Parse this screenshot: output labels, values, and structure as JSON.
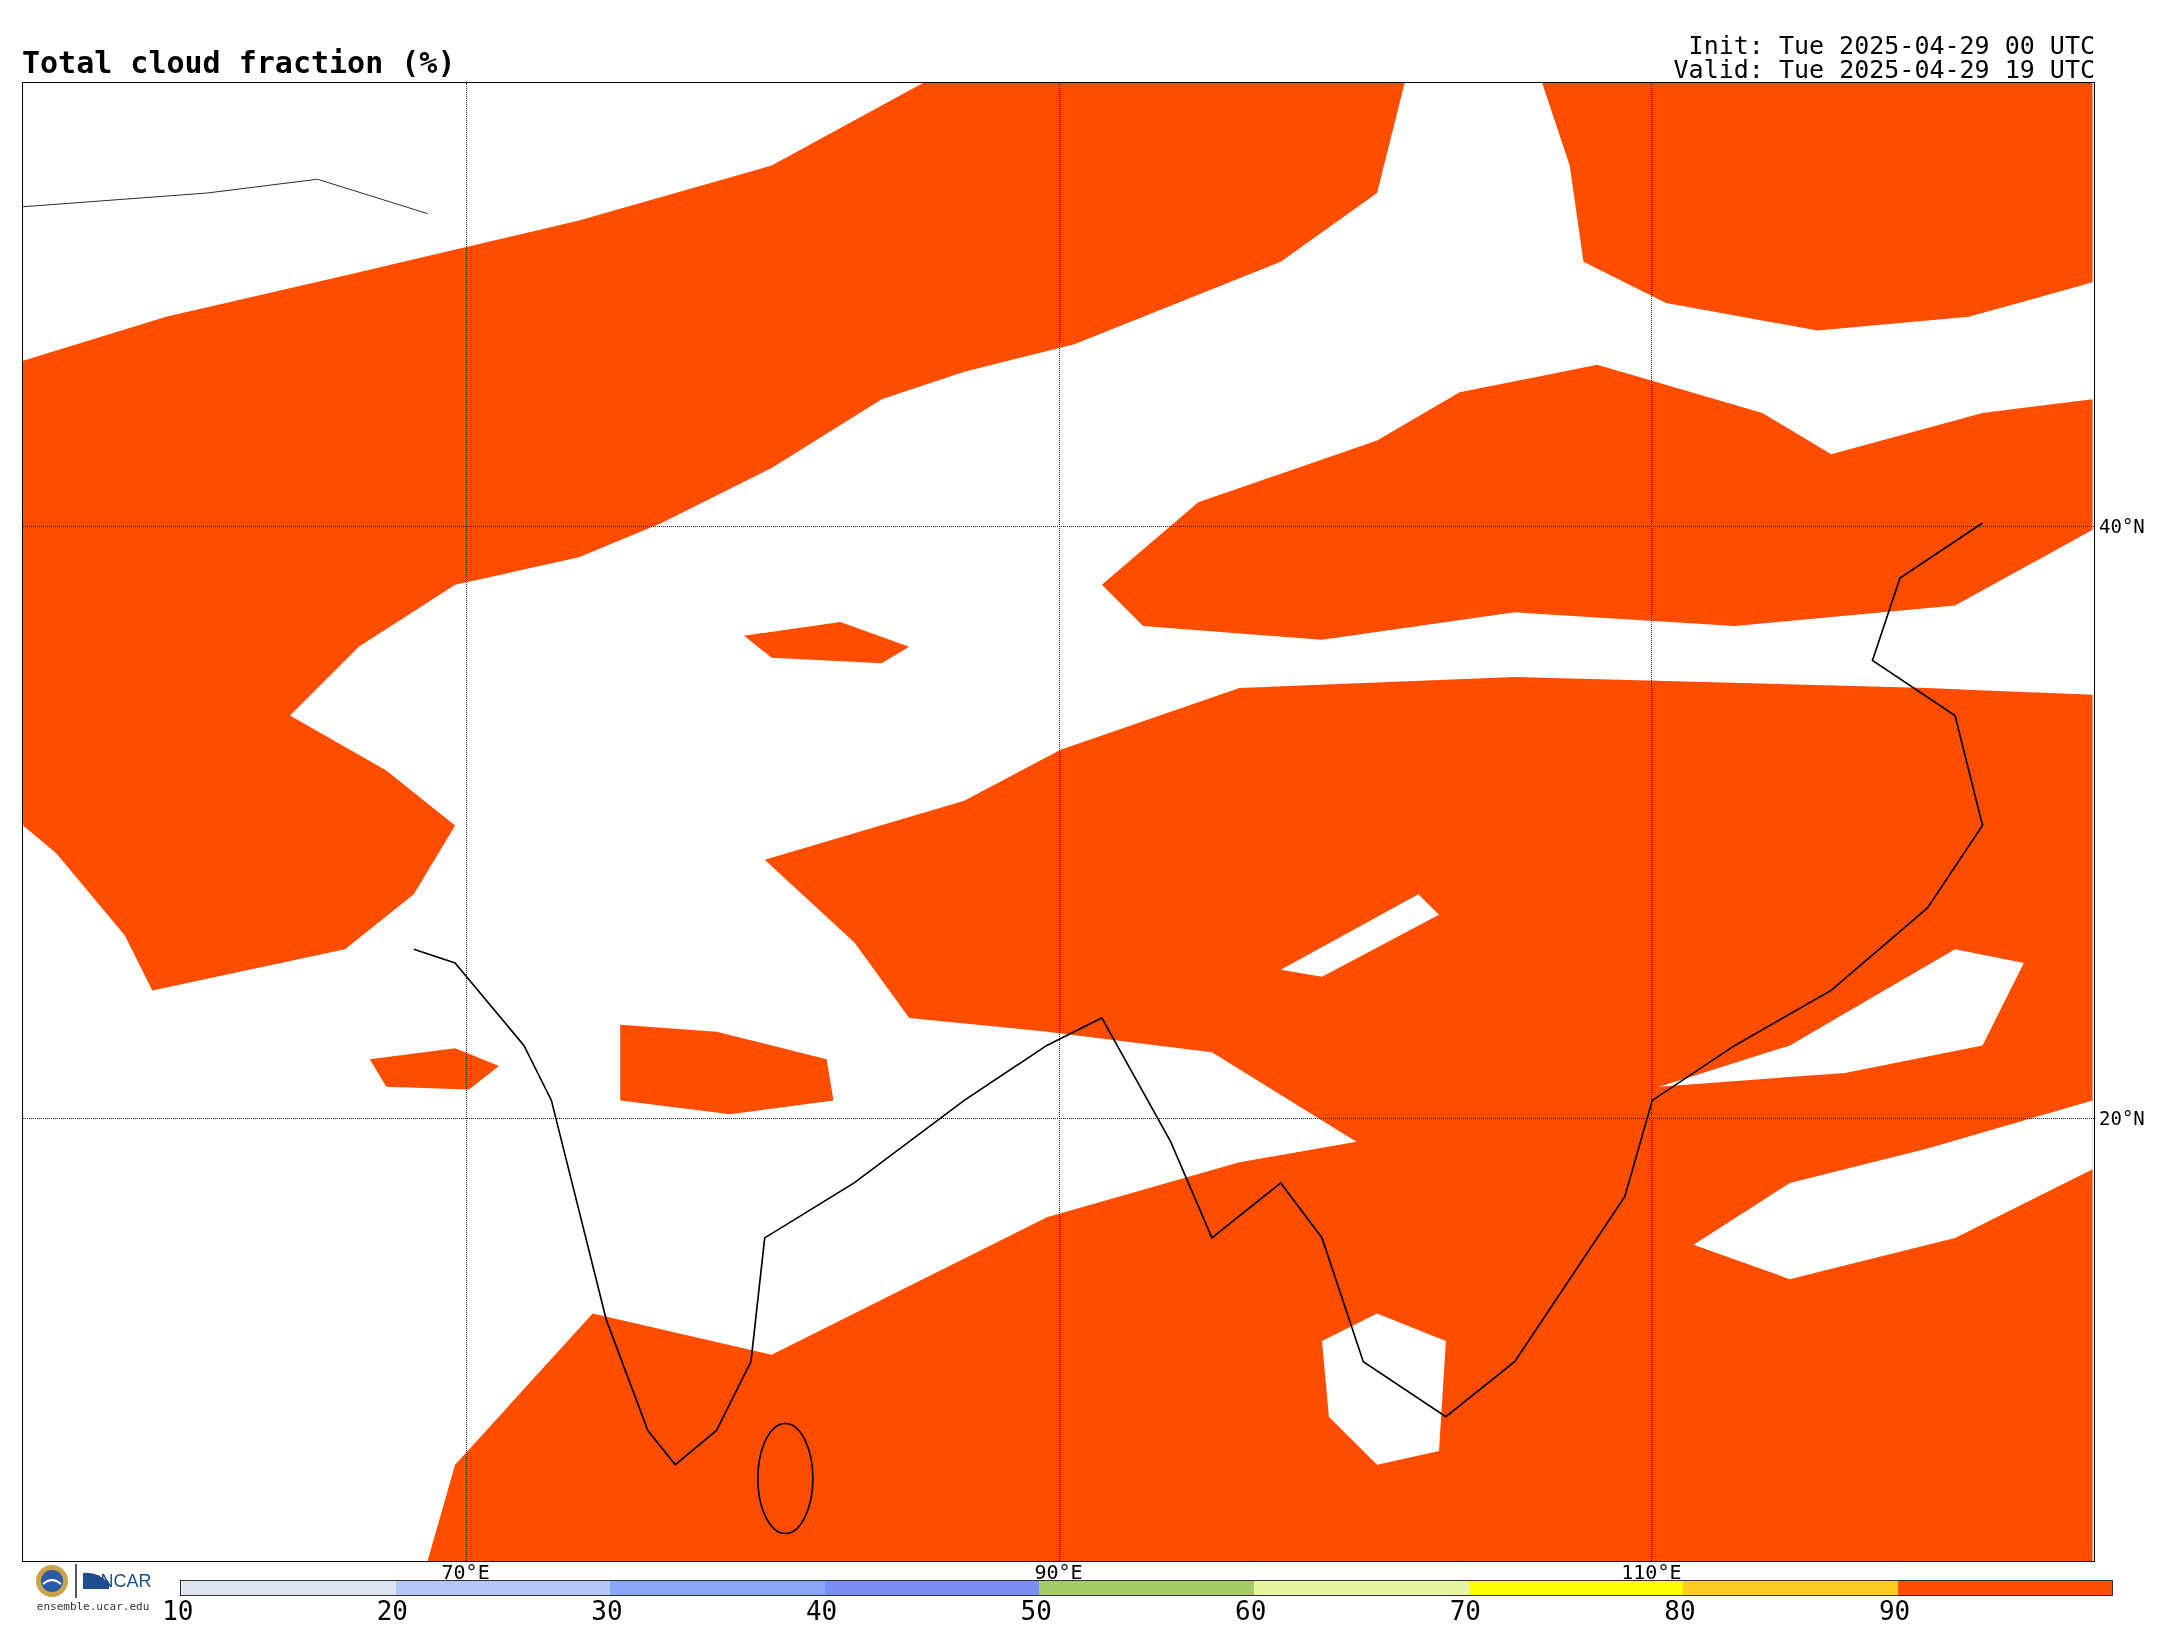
{
  "title": "Total cloud fraction (%)",
  "init": "Init: Tue 2025-04-29 00 UTC",
  "valid": "Valid: Tue 2025-04-29 19 UTC",
  "map": {
    "lat_labels": [
      "40°N",
      "20°N"
    ],
    "lon_labels": [
      "70°E",
      "90°E",
      "110°E"
    ]
  },
  "logo": {
    "text": "NCAR",
    "url": "ensemble.ucar.edu"
  },
  "colorbar": {
    "segments": [
      {
        "color": "#dde6ee"
      },
      {
        "color": "#b3c8f5"
      },
      {
        "color": "#8aa8f5"
      },
      {
        "color": "#7b8ef5"
      },
      {
        "color": "#a5cc66"
      },
      {
        "color": "#e8f5a0"
      },
      {
        "color": "#ffff00"
      },
      {
        "color": "#ffcc22"
      },
      {
        "color": "#ff4d00"
      }
    ],
    "ticks": [
      "10",
      "20",
      "30",
      "40",
      "50",
      "60",
      "70",
      "80",
      "90"
    ]
  }
}
